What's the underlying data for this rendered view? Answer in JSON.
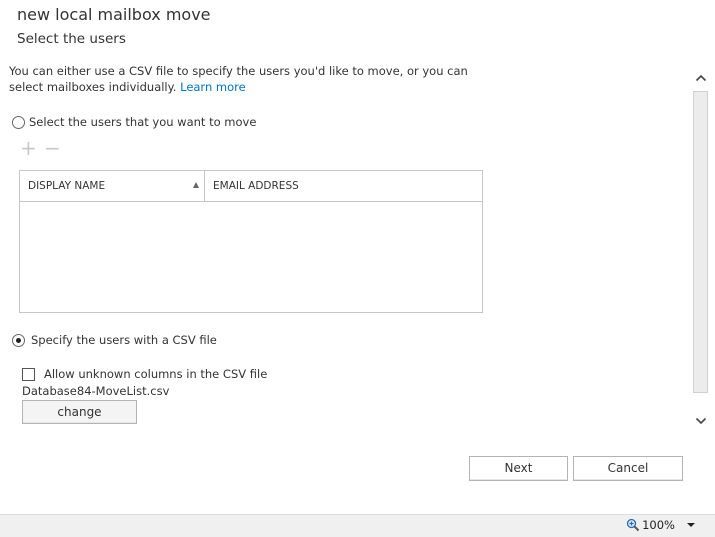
{
  "header": {
    "title": "new local mailbox move",
    "subtitle": "Select the users"
  },
  "intro": {
    "text": "You can either use a CSV file to specify the users you'd like to move, or you can select mailboxes individually.",
    "link": "Learn more"
  },
  "options": {
    "select_users_label": "Select the users that you want to move",
    "select_users_checked": false,
    "csv_label": "Specify the users with a CSV file",
    "csv_checked": true
  },
  "toolbar": {
    "add_icon": "plus-icon",
    "remove_icon": "minus-icon",
    "add_glyph": "+",
    "remove_glyph": "−"
  },
  "grid": {
    "columns": [
      "DISPLAY NAME",
      "EMAIL ADDRESS"
    ],
    "sort_column": "DISPLAY NAME",
    "sort_direction": "ascending",
    "rows": []
  },
  "csv": {
    "allow_unknown_label": "Allow unknown columns in the CSV file",
    "allow_unknown_checked": false,
    "filename": "Database84-MoveList.csv",
    "change_label": "change"
  },
  "footer": {
    "next_label": "Next",
    "cancel_label": "Cancel"
  },
  "statusbar": {
    "zoom": "100%",
    "zoom_icon": "magnifier-plus-icon"
  },
  "colors": {
    "link": "#0072c6",
    "disabled_icon": "#c8c8c8",
    "border": "#c6c6c6"
  }
}
